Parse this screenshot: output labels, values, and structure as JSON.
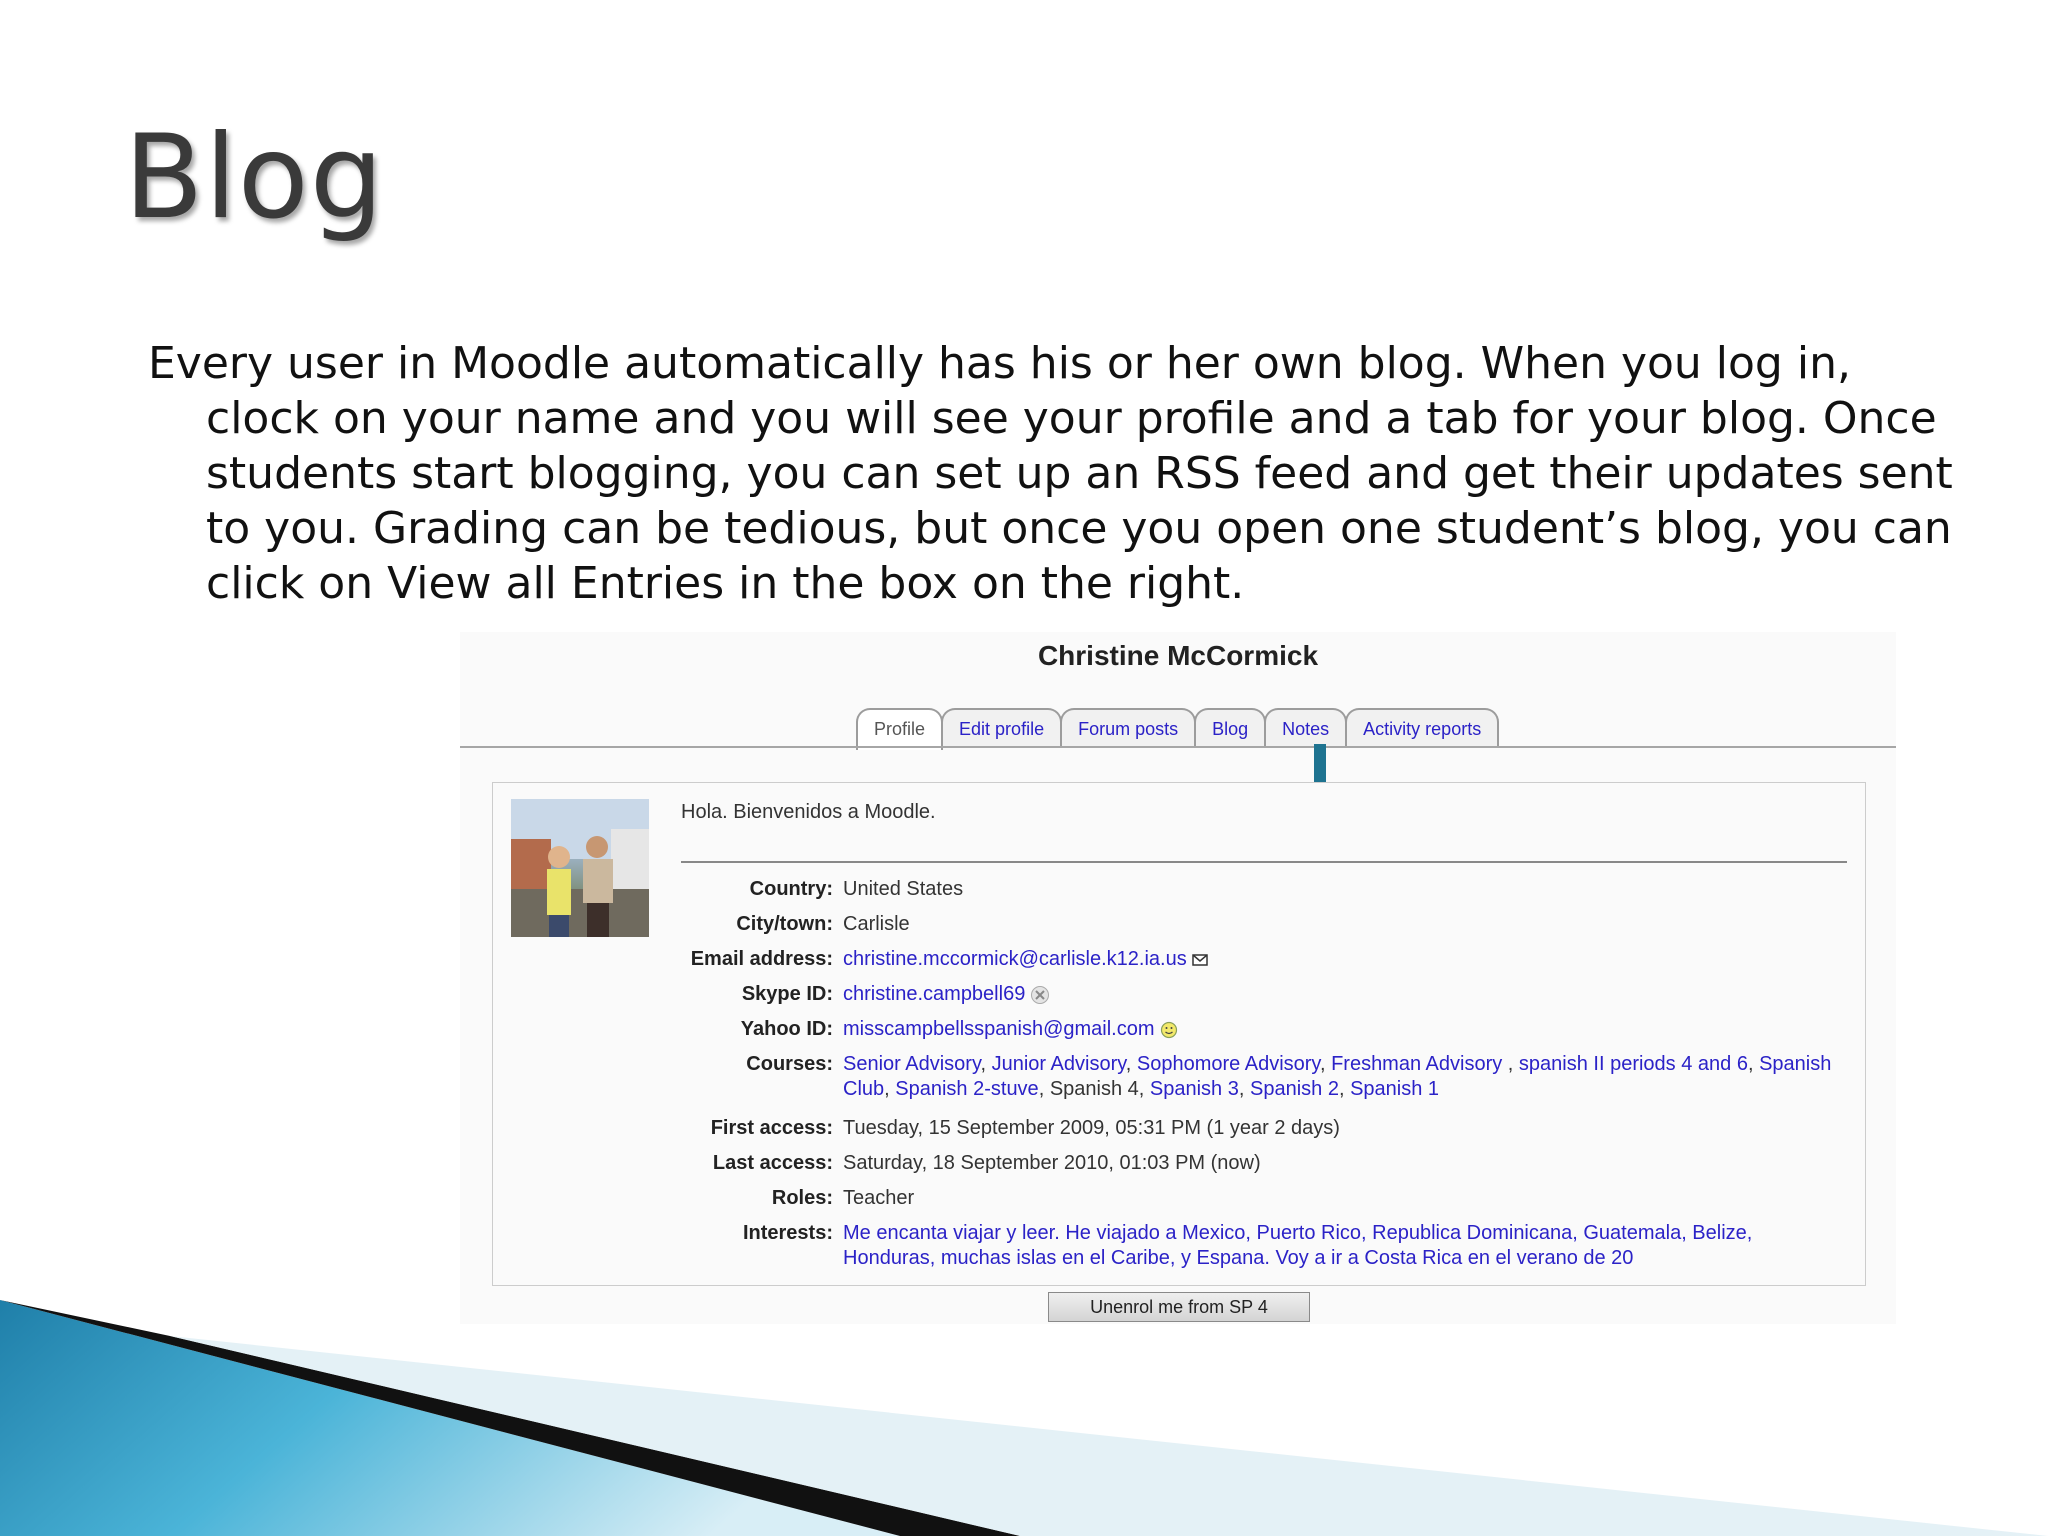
{
  "slide": {
    "title": "Blog",
    "body": "Every user in Moodle automatically has his or her own blog.  When you log in, clock on your name and you will see your profile and a tab for your blog. Once students start blogging, you can set up an RSS feed and get their updates sent to you. Grading can be tedious, but once you open one student’s blog, you can click on View all Entries in the box on the right."
  },
  "profile": {
    "name": "Christine McCormick",
    "tabs": [
      "Profile",
      "Edit profile",
      "Forum posts",
      "Blog",
      "Notes",
      "Activity reports"
    ],
    "active_tab": "Profile",
    "description": "Hola. Bienvenidos a Moodle.",
    "fields": {
      "country": {
        "label": "Country:",
        "value": "United States"
      },
      "city": {
        "label": "City/town:",
        "value": "Carlisle"
      },
      "email": {
        "label": "Email address:",
        "value": "christine.mccormick@carlisle.k12.ia.us",
        "icon": "envelope-icon"
      },
      "skype": {
        "label": "Skype ID:",
        "value": "christine.campbell69",
        "icon": "skype-icon"
      },
      "yahoo": {
        "label": "Yahoo ID:",
        "value": "misscampbellsspanish@gmail.com",
        "icon": "yahoo-smiley-icon"
      },
      "courses": {
        "label": "Courses:",
        "items": [
          {
            "text": "Senior Advisory",
            "sep": ", ",
            "link": true
          },
          {
            "text": "Junior Advisory",
            "sep": ", ",
            "link": true
          },
          {
            "text": "Sophomore Advisory",
            "sep": ", ",
            "link": true
          },
          {
            "text": "Freshman Advisory ",
            "sep": ", ",
            "link": true
          },
          {
            "text": "spanish II periods 4 and 6",
            "sep": ", ",
            "link": true
          },
          {
            "text": "Spanish Club",
            "sep": ", ",
            "link": true
          },
          {
            "text": "Spanish 2-stuve",
            "sep": ", ",
            "link": true
          },
          {
            "text": "Spanish 4",
            "sep": ", ",
            "link": false
          },
          {
            "text": "Spanish 3",
            "sep": ", ",
            "link": true
          },
          {
            "text": "Spanish 2",
            "sep": ", ",
            "link": true
          },
          {
            "text": "Spanish 1",
            "sep": "",
            "link": true
          }
        ]
      },
      "first_access": {
        "label": "First access:",
        "value": "Tuesday, 15 September 2009, 05:31 PM  (1 year 2 days)"
      },
      "last_access": {
        "label": "Last access:",
        "value": "Saturday, 18 September 2010, 01:03 PM  (now)"
      },
      "roles": {
        "label": "Roles:",
        "value": "Teacher"
      },
      "interests": {
        "label": "Interests:",
        "value": "Me encanta viajar y leer. He viajado a Mexico, Puerto Rico, Republica Dominicana, Guatemala, Belize, Honduras, muchas islas en el Caribe, y Espana. Voy a ir a Costa Rica en el verano de 20"
      }
    },
    "unenrol_label": "Unenrol me from SP 4"
  },
  "colors": {
    "link": "#2b22c7",
    "arrow": "#1e7390",
    "ribbon_blue": "#2f9cc4",
    "ribbon_dark": "#111111"
  }
}
